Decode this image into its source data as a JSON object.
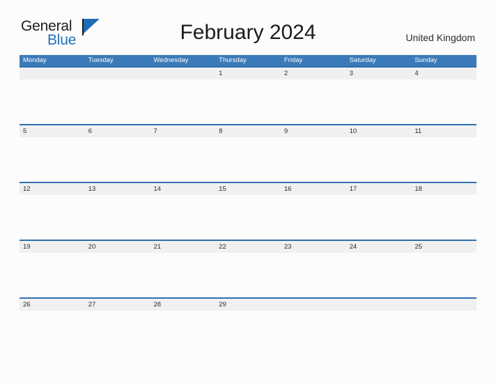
{
  "brand": {
    "name_part1": "General",
    "name_part2": "Blue",
    "flag_icon": "flag-triangle-icon",
    "accent_color": "#1f6fb8"
  },
  "header": {
    "title": "February 2024",
    "region": "United Kingdom"
  },
  "colors": {
    "header_blue": "#3b7ab8",
    "rule_blue": "#2f6fae",
    "date_band_gray": "#f0f0f0",
    "page_background": "#fcfcfd",
    "text_dark": "#1b1b1b"
  },
  "calendar": {
    "month": "February",
    "year": "2024",
    "first_day_of_week": "Monday",
    "weekdays": [
      "Monday",
      "Tuesday",
      "Wednesday",
      "Thursday",
      "Friday",
      "Saturday",
      "Sunday"
    ],
    "weeks": [
      {
        "days": [
          "",
          "",
          "",
          "1",
          "2",
          "3",
          "4"
        ]
      },
      {
        "days": [
          "5",
          "6",
          "7",
          "8",
          "9",
          "10",
          "11"
        ]
      },
      {
        "days": [
          "12",
          "13",
          "14",
          "15",
          "16",
          "17",
          "18"
        ]
      },
      {
        "days": [
          "19",
          "20",
          "21",
          "22",
          "23",
          "24",
          "25"
        ]
      },
      {
        "days": [
          "26",
          "27",
          "28",
          "29",
          "",
          "",
          ""
        ]
      }
    ]
  }
}
